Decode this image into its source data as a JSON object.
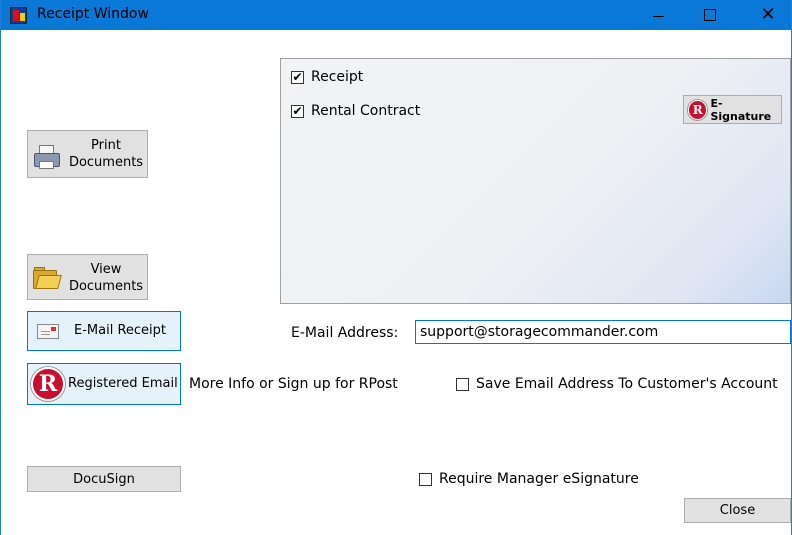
{
  "window": {
    "title": "Receipt Window",
    "controls": {
      "minimize_icon": "minimize-icon",
      "maximize_icon": "maximize-icon",
      "close_glyph": "✕"
    }
  },
  "buttons": {
    "print_line1": "Print",
    "print_line2": "Documents",
    "view_line1": "View",
    "view_line2": "Documents",
    "email_receipt": "E-Mail Receipt",
    "registered_email": "Registered Email",
    "docusign": "DocuSign",
    "close": "Close",
    "esignature": "E-Signature",
    "rpost_logo_letter": "R"
  },
  "documents": {
    "items": [
      {
        "label": "Receipt",
        "checked": true
      },
      {
        "label": "Rental Contract",
        "checked": true
      }
    ]
  },
  "email": {
    "label": "E-Mail Address:",
    "value": "support@storagecommander.com"
  },
  "rpost": {
    "link_text": "More Info or Sign up for RPost"
  },
  "options": {
    "save_email": {
      "label": "Save Email Address To Customer's Account",
      "checked": false
    },
    "manager_esig": {
      "label": "Require Manager eSignature",
      "checked": false
    }
  },
  "colors": {
    "titlebar": "#0a78d7",
    "accent": "#0078d7",
    "rpost_red": "#c8102e"
  }
}
